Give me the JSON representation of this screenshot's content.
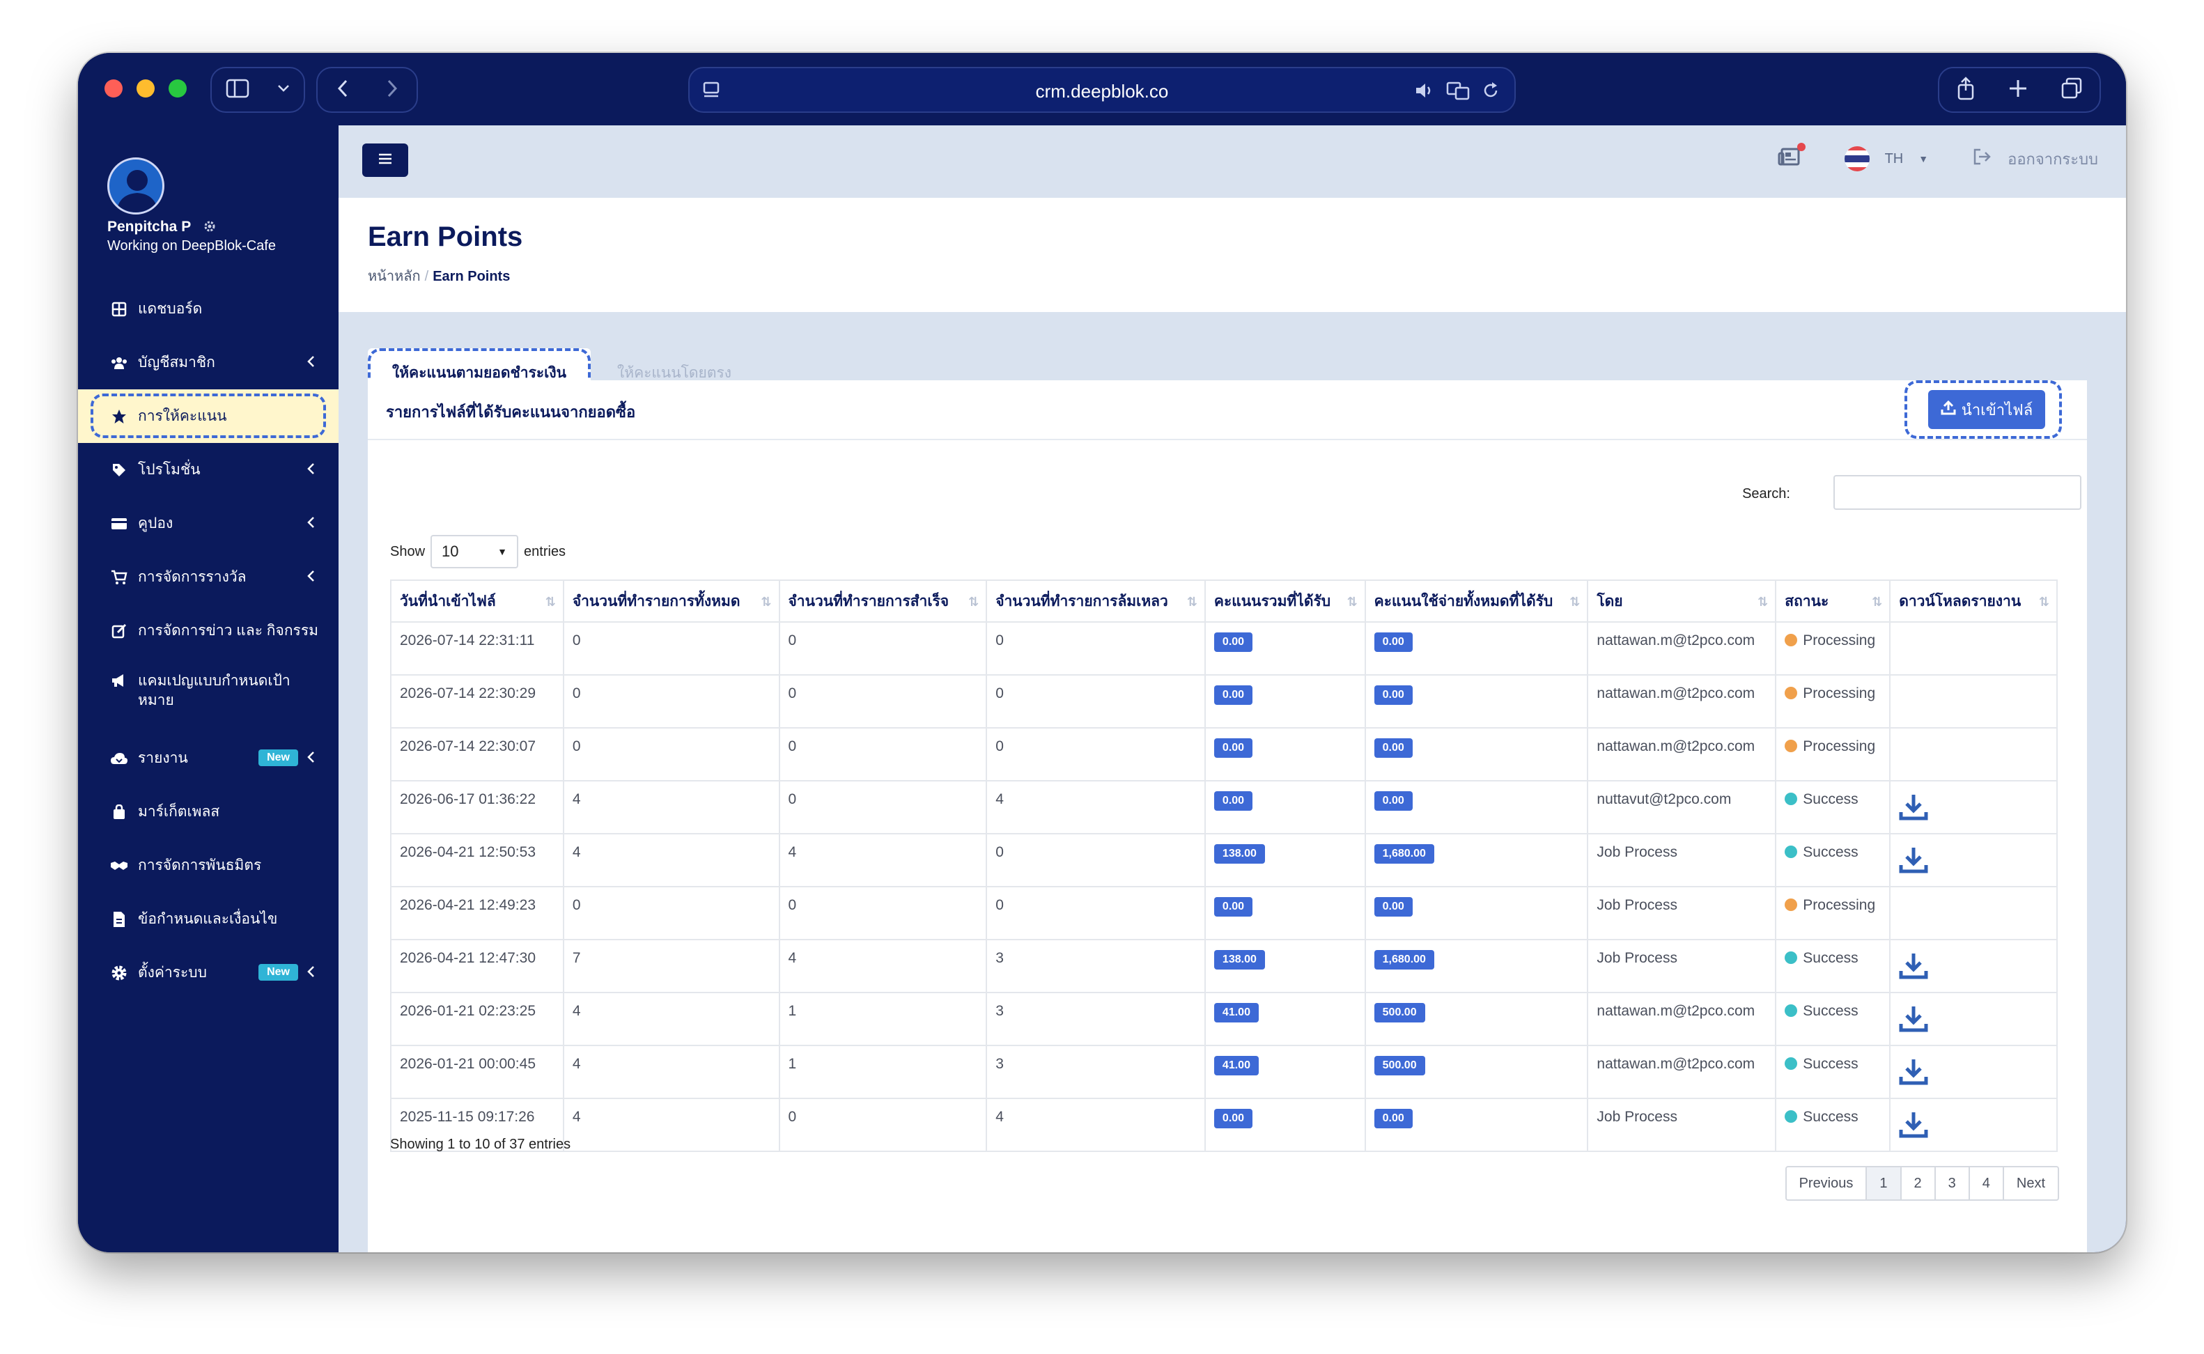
{
  "browser": {
    "url": "crm.deepblok.co"
  },
  "user": {
    "name": "Penpitcha P",
    "working_on": "Working on DeepBlok-Cafe"
  },
  "sidebar": {
    "items": [
      {
        "label": "แดชบอร์ด",
        "icon": "grid-icon"
      },
      {
        "label": "บัญชีสมาชิก",
        "icon": "users-icon"
      },
      {
        "label": "การให้คะแนน",
        "icon": "star-icon"
      },
      {
        "label": "โปรโมชั่น",
        "icon": "tag-icon"
      },
      {
        "label": "คูปอง",
        "icon": "card-icon"
      },
      {
        "label": "การจัดการรางวัล",
        "icon": "cart-icon"
      },
      {
        "label": "การจัดการข่าว และ กิจกรรม",
        "icon": "edit-icon"
      },
      {
        "label": "แคมเปญแบบกำหนดเป้าหมาย",
        "icon": "megaphone-icon"
      },
      {
        "label": "รายงาน",
        "icon": "cloud-icon",
        "badge": "New"
      },
      {
        "label": "มาร์เก็ตเพลส",
        "icon": "bag-icon"
      },
      {
        "label": "การจัดการพันธมิตร",
        "icon": "handshake-icon"
      },
      {
        "label": "ข้อกำหนดและเงื่อนไข",
        "icon": "document-icon"
      },
      {
        "label": "ตั้งค่าระบบ",
        "icon": "gear-icon",
        "badge": "New"
      }
    ]
  },
  "topbar": {
    "language": "TH",
    "logout_label": "ออกจากระบบ"
  },
  "page": {
    "title": "Earn Points",
    "breadcrumb_home": "หน้าหลัก",
    "breadcrumb_current": "Earn Points"
  },
  "tabs": {
    "active": "ให้คะแนนตามยอดชำระเงิน",
    "inactive": "ให้คะแนนโดยตรง"
  },
  "card": {
    "title": "รายการไฟล์ที่ได้รับคะแนนจากยอดซื้อ",
    "import_label": "นำเข้าไฟล์"
  },
  "table_controls": {
    "search_label": "Search:",
    "show_label": "Show",
    "entries_label": "entries",
    "page_size": "10"
  },
  "table": {
    "columns": [
      "วันที่นำเข้าไฟล์",
      "จำนวนที่ทำรายการทั้งหมด",
      "จำนวนที่ทำรายการสำเร็จ",
      "จำนวนที่ทำรายการล้มเหลว",
      "คะแนนรวมที่ได้รับ",
      "คะแนนใช้จ่ายทั้งหมดที่ได้รับ",
      "โดย",
      "สถานะ",
      "ดาวน์โหลดรายงาน"
    ],
    "rows": [
      {
        "date": "2026-07-14 22:31:11",
        "total": "0",
        "success": "0",
        "failed": "0",
        "points": "0.00",
        "spend": "0.00",
        "by": "nattawan.m@t2pco.com",
        "status": "Processing",
        "download": false
      },
      {
        "date": "2026-07-14 22:30:29",
        "total": "0",
        "success": "0",
        "failed": "0",
        "points": "0.00",
        "spend": "0.00",
        "by": "nattawan.m@t2pco.com",
        "status": "Processing",
        "download": false
      },
      {
        "date": "2026-07-14 22:30:07",
        "total": "0",
        "success": "0",
        "failed": "0",
        "points": "0.00",
        "spend": "0.00",
        "by": "nattawan.m@t2pco.com",
        "status": "Processing",
        "download": false
      },
      {
        "date": "2026-06-17 01:36:22",
        "total": "4",
        "success": "0",
        "failed": "4",
        "points": "0.00",
        "spend": "0.00",
        "by": "nuttavut@t2pco.com",
        "status": "Success",
        "download": true
      },
      {
        "date": "2026-04-21 12:50:53",
        "total": "4",
        "success": "4",
        "failed": "0",
        "points": "138.00",
        "spend": "1,680.00",
        "by": "Job Process",
        "status": "Success",
        "download": true
      },
      {
        "date": "2026-04-21 12:49:23",
        "total": "0",
        "success": "0",
        "failed": "0",
        "points": "0.00",
        "spend": "0.00",
        "by": "Job Process",
        "status": "Processing",
        "download": false
      },
      {
        "date": "2026-04-21 12:47:30",
        "total": "7",
        "success": "4",
        "failed": "3",
        "points": "138.00",
        "spend": "1,680.00",
        "by": "Job Process",
        "status": "Success",
        "download": true
      },
      {
        "date": "2026-01-21 02:23:25",
        "total": "4",
        "success": "1",
        "failed": "3",
        "points": "41.00",
        "spend": "500.00",
        "by": "nattawan.m@t2pco.com",
        "status": "Success",
        "download": true
      },
      {
        "date": "2026-01-21 00:00:45",
        "total": "4",
        "success": "1",
        "failed": "3",
        "points": "41.00",
        "spend": "500.00",
        "by": "nattawan.m@t2pco.com",
        "status": "Success",
        "download": true
      },
      {
        "date": "2025-11-15 09:17:26",
        "total": "4",
        "success": "0",
        "failed": "4",
        "points": "0.00",
        "spend": "0.00",
        "by": "Job Process",
        "status": "Success",
        "download": true
      }
    ]
  },
  "footer": {
    "showing": "Showing 1 to 10 of 37 entries",
    "previous": "Previous",
    "pages": [
      "1",
      "2",
      "3",
      "4"
    ],
    "next": "Next"
  },
  "colors": {
    "navy": "#0b1a5c",
    "accent": "#3d69d6",
    "teal": "#35b0c8",
    "red": "#e5484d",
    "processing": "#f0a04b",
    "success": "#3bbfc7"
  }
}
